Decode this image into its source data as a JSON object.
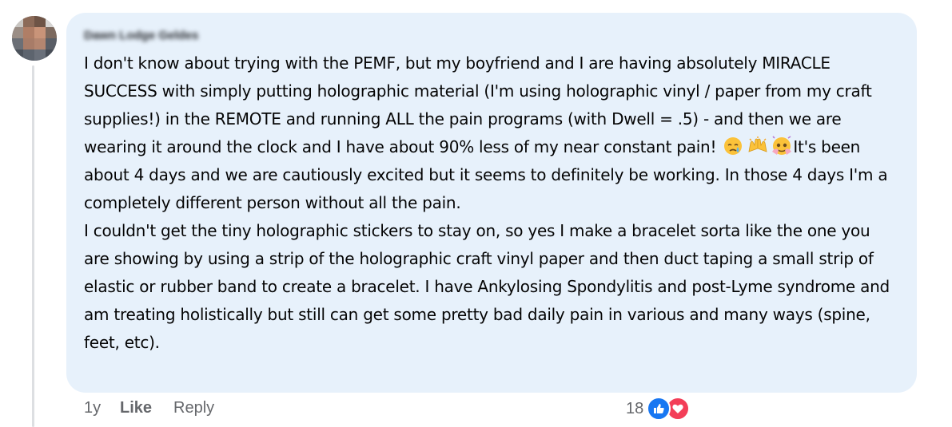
{
  "comment": {
    "author": "Dawn Lodge Geldes",
    "paragraph1_part1": "I don't know about trying with the PEMF, but my boyfriend and I are having absolutely MIRACLE SUCCESS with simply putting holographic material (I'm using holographic vinyl / paper from my craft supplies!) in the REMOTE and running ALL the pain programs (with Dwell = .5) - and then we are wearing it around the clock and I have about 90% less of my near constant pain!",
    "paragraph1_part2": "It's been about 4 days and we are cautiously excited but it seems to definitely be working. In those 4 days I'm a completely different person without all the pain.",
    "paragraph2": "I couldn't get the tiny holographic stickers to stay on, so yes I make a bracelet sorta like the one you are showing by using a strip of the holographic craft vinyl paper and then duct taping a small strip of elastic or rubber band to create a bracelet. I have Ankylosing Spondylitis and post-Lyme syndrome and am treating holistically but still can get some pretty bad daily pain in various and many ways (spine, feet, etc).",
    "emojis": [
      "crying-face-icon",
      "raising-hands-icon",
      "face-holding-back-tears-icon"
    ]
  },
  "actions": {
    "time": "1y",
    "like_label": "Like",
    "reply_label": "Reply"
  },
  "reactions": {
    "count": "18",
    "types": [
      "like-reaction-icon",
      "love-reaction-icon"
    ],
    "colors": {
      "like": "#1877f2",
      "love": "#f33e58"
    }
  },
  "colors": {
    "bubble": "#e7f1fb",
    "text": "#050505",
    "meta": "#65676b"
  }
}
